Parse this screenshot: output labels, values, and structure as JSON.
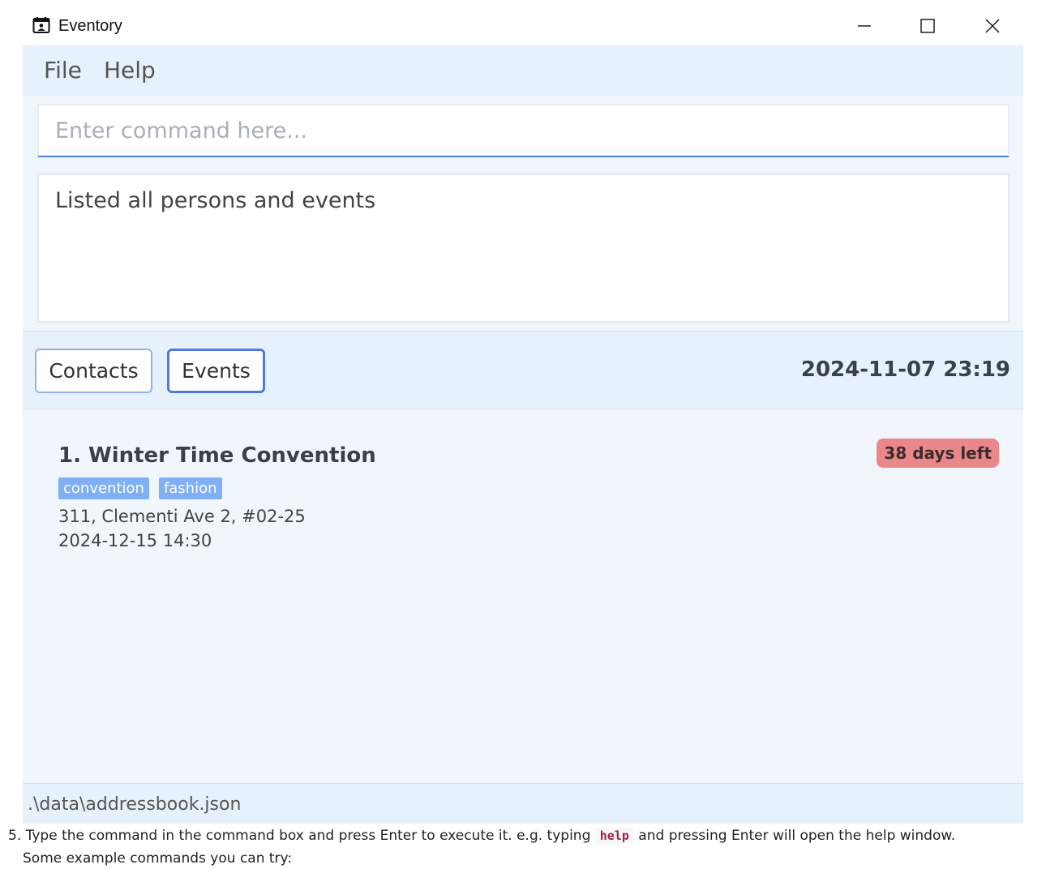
{
  "window": {
    "title": "Eventory",
    "icon": "calendar-icon",
    "controls": [
      "minimize-icon",
      "maximize-icon",
      "close-icon"
    ]
  },
  "menu": {
    "file": "File",
    "help": "Help"
  },
  "command": {
    "value": "",
    "placeholder": "Enter command here..."
  },
  "result": {
    "message": "Listed all persons and events"
  },
  "tabs": {
    "contacts": "Contacts",
    "events": "Events",
    "active": "Events"
  },
  "clock": "2024-11-07 23:19",
  "events": [
    {
      "index": "1.",
      "name": "Winter Time Convention",
      "title_full": "1. Winter Time Convention",
      "tags": [
        "convention",
        "fashion"
      ],
      "address": "311, Clementi Ave 2, #02-25",
      "datetime": "2024-12-15 14:30",
      "countdown": "38 days left"
    }
  ],
  "status": {
    "path": ".\\data\\addressbook.json"
  },
  "doc": {
    "step_prefix": "5. Type the command in the command box and press Enter to execute it. e.g. typing ",
    "code": "help",
    "step_suffix": " and pressing Enter will open the help window.",
    "line2": "Some example commands you can try:"
  },
  "colors": {
    "accent": "#4a7fe0",
    "panel": "#e7f1fb",
    "list_bg": "#f1f6fc",
    "tag": "#7fb0f5",
    "badge": "#e9878a"
  }
}
